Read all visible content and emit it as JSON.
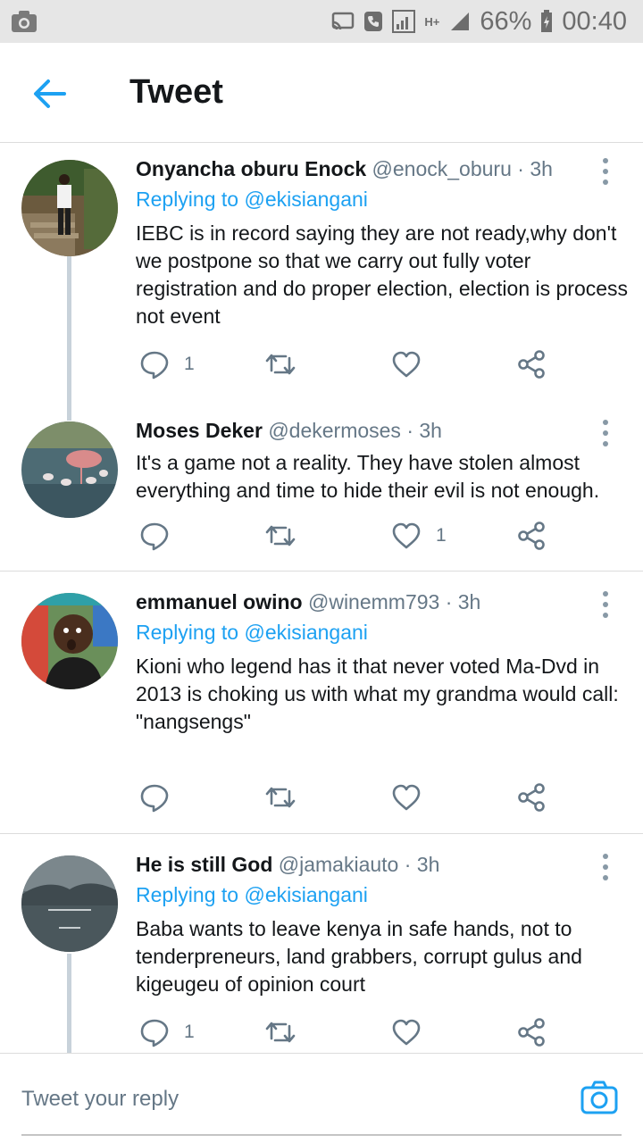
{
  "statusbar": {
    "battery": "66%",
    "time": "00:40",
    "network": "H+"
  },
  "header": {
    "title": "Tweet"
  },
  "tweets": [
    {
      "name": "Onyancha oburu Enock",
      "meta": "@enock_oburu · 3h",
      "replying_prefix": "Replying to",
      "replying_to": "@ekisiangani",
      "text": "IEBC is in record saying they are not ready,why don't we postpone so that we carry out fully voter registration and do proper election, election is process not event",
      "reply_count": "1",
      "like_count": ""
    },
    {
      "name": "Moses Deker",
      "meta": "@dekermoses · 3h",
      "text": "It's a game not a reality. They have stolen almost everything and time to hide their evil is not enough.",
      "reply_count": "",
      "like_count": "1"
    },
    {
      "name": "emmanuel owino",
      "meta": "@winemm793 · 3h",
      "replying_prefix": "Replying to",
      "replying_to": "@ekisiangani",
      "text": "Kioni who legend has it that never voted Ma-Dvd in 2013 is choking us with  what my grandma would call:\n\"nangsengs\"",
      "reply_count": "",
      "like_count": ""
    },
    {
      "name": "He is still God",
      "meta": "@jamakiauto · 3h",
      "replying_prefix": "Replying to",
      "replying_to": "@ekisiangani",
      "text": "Baba wants to leave kenya in safe hands, not to tenderpreneurs, land grabbers, corrupt gulus and kigeugeu of opinion court",
      "reply_count": "1",
      "like_count": ""
    }
  ],
  "composer": {
    "placeholder": "Tweet your reply"
  },
  "colors": {
    "accent": "#1da1f2",
    "muted": "#657786",
    "text": "#14171a",
    "icon": "#657786"
  }
}
